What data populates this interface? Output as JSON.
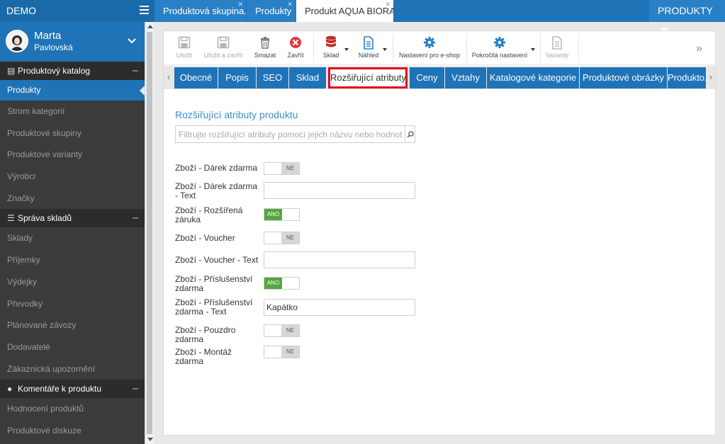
{
  "app": {
    "brand": "DEMO",
    "module_button": "PRODUKTY"
  },
  "window_tabs": [
    {
      "label": "Produktová skupina..."
    },
    {
      "label": "Produkty"
    },
    {
      "label": "Produkt AQUA BIORA..."
    }
  ],
  "user": {
    "first_name": "Marta",
    "last_name": "Pavlovská"
  },
  "sidebar": {
    "sections": [
      {
        "title": "Produktový katalog",
        "icon": "book-icon",
        "items": [
          "Produkty",
          "Strom kategorií",
          "Produktové skupiny",
          "Produktové varianty",
          "Výrobci",
          "Značky"
        ]
      },
      {
        "title": "Správa skladů",
        "icon": "database-icon",
        "items": [
          "Sklady",
          "Příjemky",
          "Výdejky",
          "Převodky",
          "Plánované závozy",
          "Dodavatelé",
          "Zákaznická upozornění"
        ]
      },
      {
        "title": "Komentáře k produktu",
        "icon": "comment-icon",
        "items": [
          "Hodnocení produktů",
          "Produktové diskuze"
        ]
      }
    ],
    "active_item": "Produkty"
  },
  "toolbar": {
    "save": "Uložit",
    "save_close": "Uložit a zavřít",
    "delete": "Smazat",
    "close": "Zavřít",
    "stock": "Sklad",
    "preview": "Náhled",
    "eshop_settings": "Nastavení pro e-shop",
    "advanced_settings": "Pokročilá nastavení",
    "variants": "Varianty"
  },
  "product_tabs": [
    "Obecné",
    "Popis",
    "SEO",
    "Sklad",
    "Rozšiřující atributy",
    "Ceny",
    "Vztahy",
    "Katalogové kategorie",
    "Produktové obrázky",
    "Produkto..."
  ],
  "active_product_tab": "Rozšiřující atributy",
  "attributes": {
    "title": "Rozšiřující atributy produktu",
    "filter_placeholder": "Filtrujte rozšiřující atributy pomocí jejich názvu nebo hodnoty",
    "rows": [
      {
        "label": "Zboží - Dárek zdarma",
        "type": "toggle",
        "value": "NE"
      },
      {
        "label": "Zboží - Dárek zdarma - Text",
        "type": "text",
        "value": ""
      },
      {
        "label": "Zboží - Rozšířená záruka",
        "type": "toggle",
        "value": "ANO"
      },
      {
        "label": "Zboží - Voucher",
        "type": "toggle",
        "value": "NE"
      },
      {
        "label": "Zboží - Voucher - Text",
        "type": "text",
        "value": ""
      },
      {
        "label": "Zboží - Příslušenství zdarma",
        "type": "toggle",
        "value": "ANO"
      },
      {
        "label": "Zboží - Příslušenství zdarma - Text",
        "type": "text",
        "value": "Kapátko"
      },
      {
        "label": "Zboží - Pouzdro zdarma",
        "type": "toggle",
        "value": "NE"
      },
      {
        "label": "Zboží - Montáž zdarma",
        "type": "toggle",
        "value": "NE"
      }
    ]
  },
  "colors": {
    "primary": "#1f73b7",
    "sidebar_bg": "#3b3b3b",
    "on": "#55a540",
    "highlight": "#e3001b"
  }
}
